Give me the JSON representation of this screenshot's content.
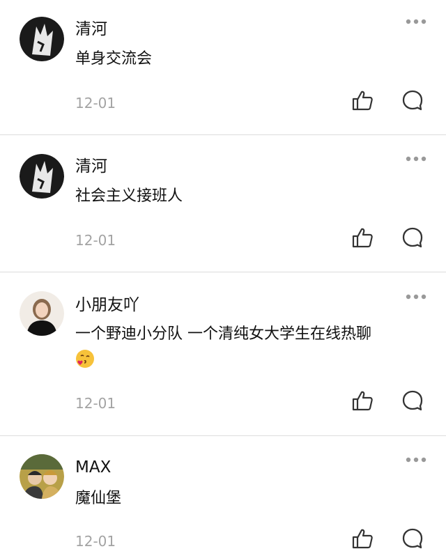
{
  "comments": [
    {
      "name": "清河",
      "text": "单身交流会",
      "date": "12-01",
      "avatar": "wolf-avatar"
    },
    {
      "name": "清河",
      "text": "社会主义接班人",
      "date": "12-01",
      "avatar": "wolf-avatar"
    },
    {
      "name": "小朋友吖",
      "text": "一个野迪小分队 一个清纯女大学生在线热聊",
      "emoji": "kiss-emoji",
      "date": "12-01",
      "avatar": "woman-avatar"
    },
    {
      "name": "MAX",
      "text": "魔仙堡",
      "date": "12-01",
      "avatar": "couple-avatar"
    }
  ],
  "colors": {
    "divider": "#dcdcdc",
    "date": "#a3a3a3",
    "icon": "#333333"
  },
  "icons": {
    "more": "more-dots-icon",
    "like": "thumbs-up-icon",
    "reply": "comment-bubble-icon"
  }
}
